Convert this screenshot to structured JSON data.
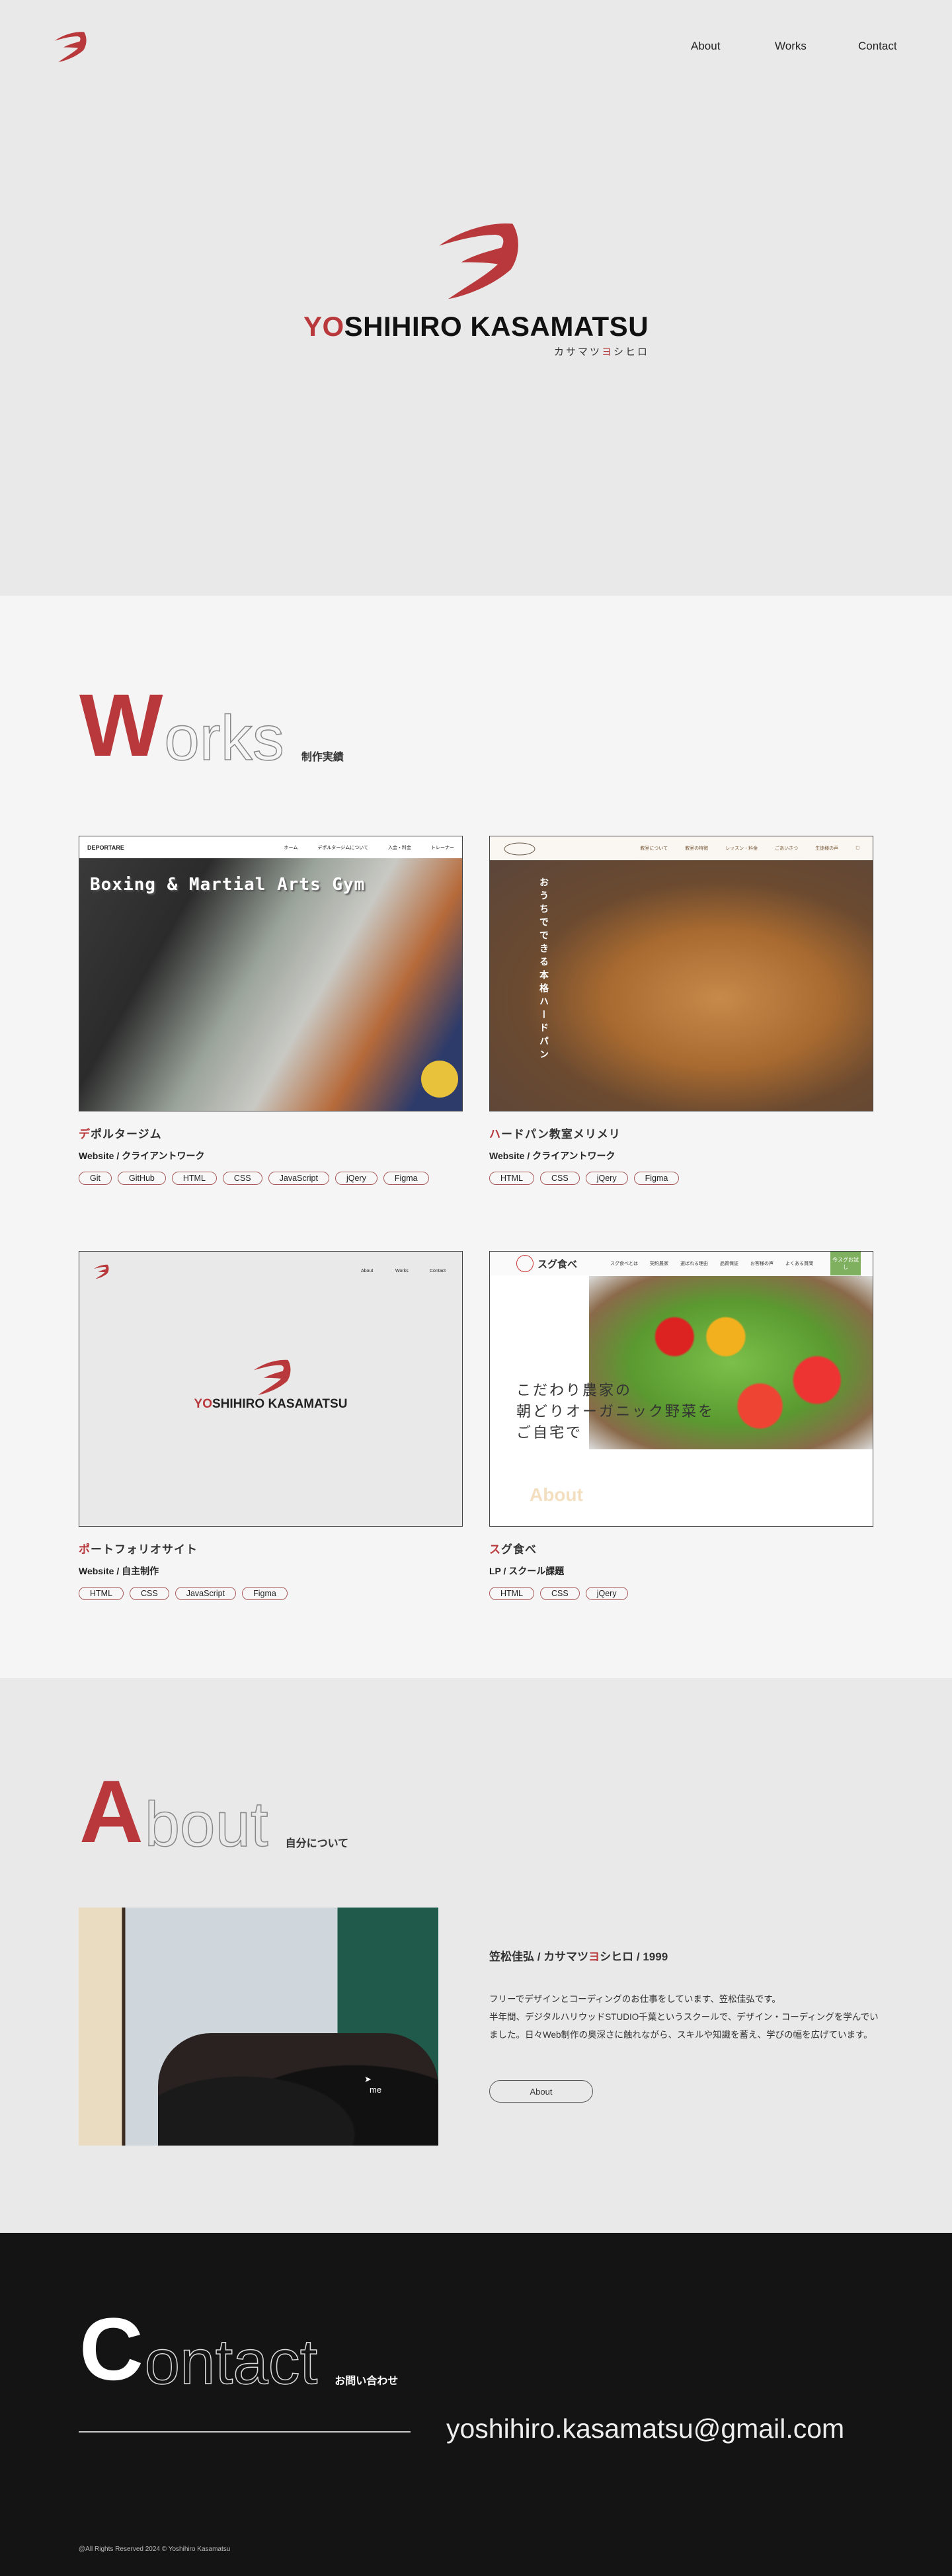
{
  "colors": {
    "accent": "#b8383c",
    "hero_bg": "#e9e9e9",
    "works_bg": "#f5f5f5",
    "contact_bg": "#141414"
  },
  "header": {
    "logo_icon": "yo-brush-logo",
    "nav": [
      "About",
      "Works",
      "Contact"
    ]
  },
  "hero": {
    "name_accent": "YO",
    "name_rest": "SHIHIRO KASAMATSU",
    "kana_a": "カサマツ",
    "kana_accent": "ヨ",
    "kana_b": "シヒロ"
  },
  "works": {
    "heading_initial": "W",
    "heading_rest": "orks",
    "heading_sub": "制作実績",
    "items": [
      {
        "title_first": "デ",
        "title_rest": "ポルタージム",
        "category": "Website / クライアントワーク",
        "tags": [
          "Git",
          "GitHub",
          "HTML",
          "CSS",
          "JavaScript",
          "jQery",
          "Figma"
        ],
        "preview": {
          "brand": "DEPORTARE",
          "headline": "Boxing & Martial Arts Gym",
          "nav": [
            "ホーム",
            "デポルタージムについて",
            "入会・料金",
            "トレーナー"
          ]
        }
      },
      {
        "title_first": "ハ",
        "title_rest": "ードパン教室メリメリ",
        "category": "Website / クライアントワーク",
        "tags": [
          "HTML",
          "CSS",
          "jQery",
          "Figma"
        ],
        "preview": {
          "nav": [
            "教室について",
            "教室の特徴",
            "レッスン・料金",
            "ごあいさつ",
            "生徒様の声"
          ],
          "headline": "おうちでできる本格ハードパン"
        }
      },
      {
        "title_first": "ポ",
        "title_rest": "ートフォリオサイト",
        "category": "Website / 自主制作",
        "tags": [
          "HTML",
          "CSS",
          "JavaScript",
          "Figma"
        ],
        "preview": {
          "nav": [
            "About",
            "Works",
            "Contact"
          ],
          "name_accent": "YO",
          "name_rest": "SHIHIRO KASAMATSU"
        }
      },
      {
        "title_first": "ス",
        "title_rest": "グ食べ",
        "category": "LP / スクール課題",
        "tags": [
          "HTML",
          "CSS",
          "jQery"
        ],
        "preview": {
          "brand": "スグ食べ",
          "nav": [
            "スグ食べとは",
            "契約農家",
            "選ばれる理由",
            "品質保証",
            "お客様の声",
            "よくある質問"
          ],
          "cta": "今スグお試し",
          "headline": "こだわり農家の\n朝どりオーガニック野菜を\nご自宅で",
          "section": "About"
        }
      }
    ]
  },
  "about": {
    "heading_initial": "A",
    "heading_rest": "bout",
    "heading_sub": "自分について",
    "photo_label": "me",
    "name_a": "笠松佳弘 / カサマツ",
    "name_accent": "ヨ",
    "name_b": "シヒロ / 1999",
    "paragraph": "フリーでデザインとコーディングのお仕事をしています、笠松佳弘です。\n半年間、デジタルハリウッドSTUDIO千葉というスクールで、デザイン・コーディングを学んでいました。日々Web制作の奥深さに触れながら、スキルや知識を蓄え、学びの幅を広げています。",
    "button": "About"
  },
  "contact": {
    "heading_initial": "C",
    "heading_rest": "ontact",
    "heading_sub": "お問い合わせ",
    "email": "yoshihiro.kasamatsu@gmail.com"
  },
  "footer": {
    "copyright": "@All Rights Reserved 2024 © Yoshihiro Kasamatsu"
  }
}
